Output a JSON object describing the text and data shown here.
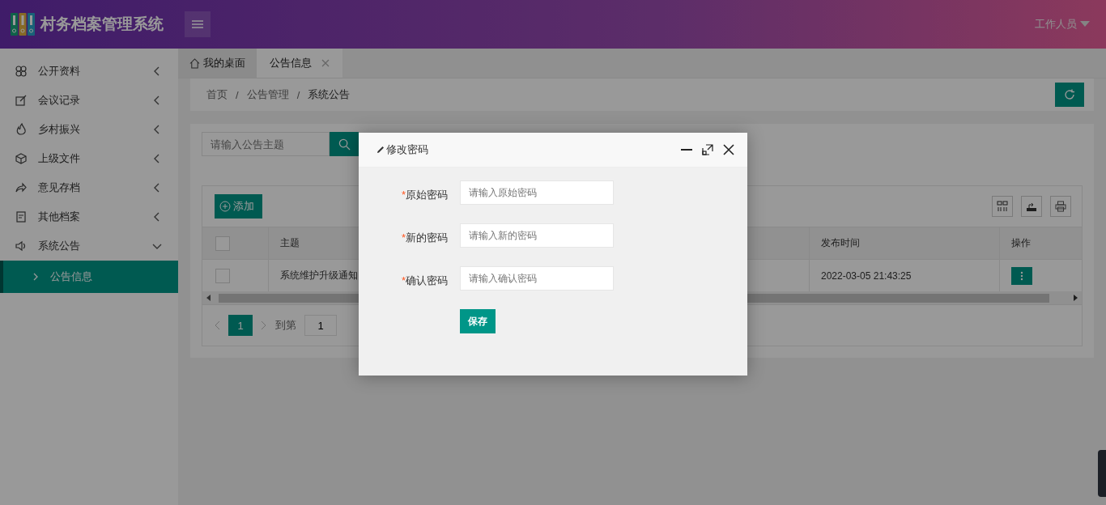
{
  "header": {
    "title": "村务档案管理系统",
    "user": "工作人员"
  },
  "sidebar": {
    "items": [
      {
        "label": "公开资料",
        "expanded": false
      },
      {
        "label": "会议记录",
        "expanded": false
      },
      {
        "label": "乡村振兴",
        "expanded": false
      },
      {
        "label": "上级文件",
        "expanded": false
      },
      {
        "label": "意见存档",
        "expanded": false
      },
      {
        "label": "其他档案",
        "expanded": false
      },
      {
        "label": "系统公告",
        "expanded": true,
        "children": [
          {
            "label": "公告信息",
            "selected": true
          }
        ]
      }
    ]
  },
  "tabs": [
    {
      "label": "我的桌面",
      "selected": false,
      "closable": false
    },
    {
      "label": "公告信息",
      "selected": true,
      "closable": true
    }
  ],
  "breadcrumb": {
    "items": [
      "首页",
      "公告管理",
      "系统公告"
    ],
    "separator": "/"
  },
  "search": {
    "placeholder": "请输入公告主题"
  },
  "add_button": "添加",
  "table": {
    "header_checked": false,
    "columns": [
      "主题",
      "发布时间",
      "操作"
    ],
    "rows": [
      {
        "checked": false,
        "cells": [
          "系统维护升级通知",
          "2022-03-05 21:43:25"
        ]
      }
    ]
  },
  "pagination": {
    "pages": [
      {
        "label": "1",
        "selected": true
      }
    ],
    "goto_label": "到第",
    "goto_value": "1"
  },
  "dialog": {
    "title": "修改密码",
    "fields": [
      {
        "label": "原始密码",
        "placeholder": "请输入原始密码",
        "required": true
      },
      {
        "label": "新的密码",
        "placeholder": "请输入新的密码",
        "required": true
      },
      {
        "label": "确认密码",
        "placeholder": "请输入确认密码",
        "required": true
      }
    ],
    "required_mark": "*",
    "save": "保存"
  }
}
